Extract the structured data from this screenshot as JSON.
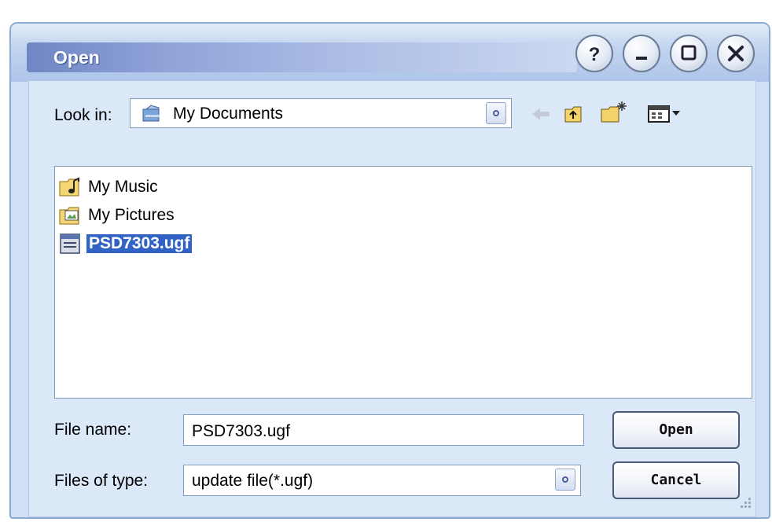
{
  "window": {
    "title": "Open"
  },
  "titlebar_buttons": [
    {
      "name": "help",
      "symbol": "?"
    },
    {
      "name": "minimize",
      "symbol": "—"
    },
    {
      "name": "maximize",
      "symbol": "□"
    },
    {
      "name": "close",
      "symbol": "✕"
    }
  ],
  "look_in": {
    "label": "Look in:",
    "value": "My Documents",
    "icon": "my-documents-icon"
  },
  "toolbar": {
    "icons": [
      "back-arrow-icon",
      "up-folder-icon",
      "new-folder-icon",
      "view-menu-icon"
    ]
  },
  "files": [
    {
      "name": "My Music",
      "icon": "music-folder-icon",
      "selected": false
    },
    {
      "name": "My Pictures",
      "icon": "pictures-folder-icon",
      "selected": false
    },
    {
      "name": "PSD7303.ugf",
      "icon": "file-icon",
      "selected": true
    }
  ],
  "file_name": {
    "label": "File name:",
    "value": "PSD7303.ugf"
  },
  "file_type": {
    "label": "Files of type:",
    "value": "update file(*.ugf)"
  },
  "buttons": {
    "open": "Open",
    "cancel": "Cancel"
  },
  "colors": {
    "selection": "#3163c5",
    "title_band": "#8fa3d8",
    "panel": "#dbe8f7"
  }
}
